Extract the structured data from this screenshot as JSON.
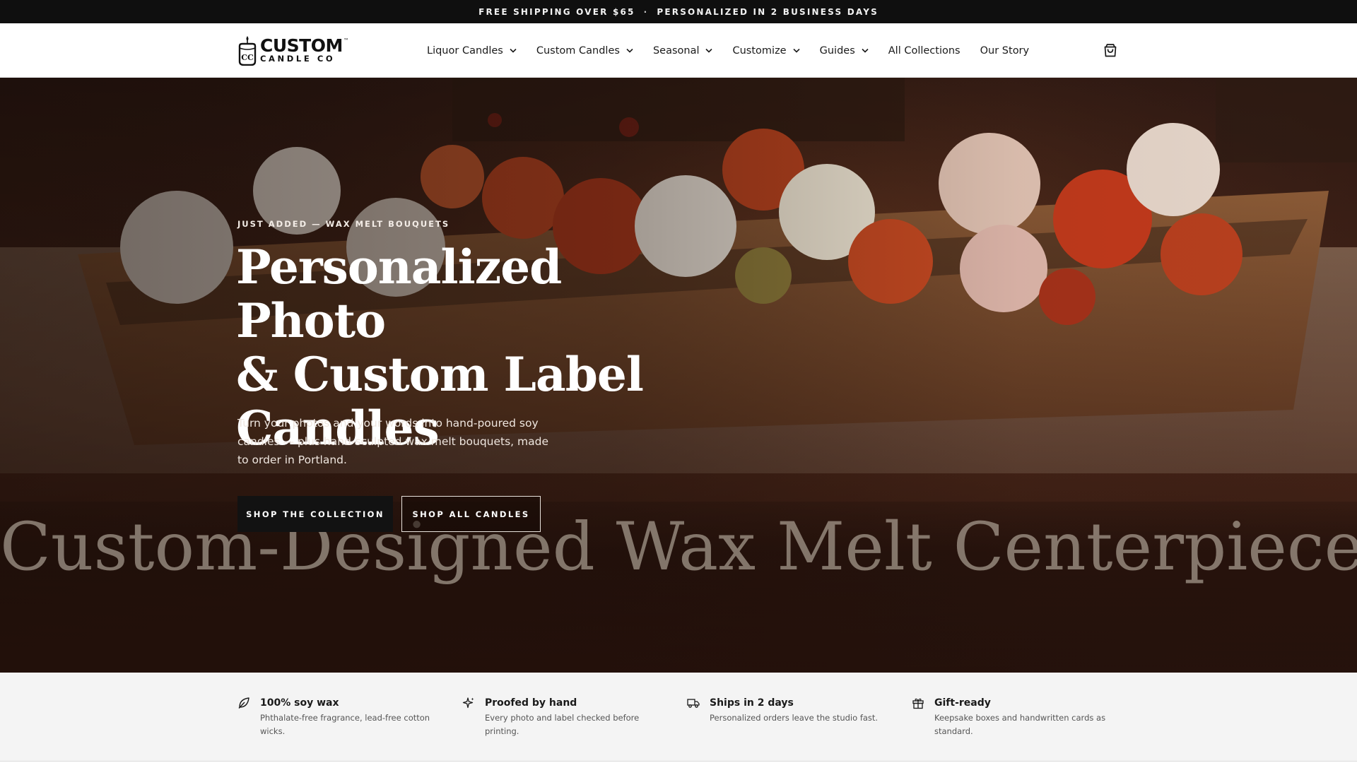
{
  "announcement": {
    "left": "FREE SHIPPING OVER $65",
    "separator": "·",
    "right": "PERSONALIZED IN 2 BUSINESS DAYS"
  },
  "header": {
    "logo": {
      "word": "CUSTOM",
      "tm": "™",
      "sub": "CANDLE CO",
      "mark_letters": "CC"
    },
    "nav": [
      {
        "label": "Liquor Candles",
        "dropdown": true
      },
      {
        "label": "Custom Candles",
        "dropdown": true
      },
      {
        "label": "Seasonal",
        "dropdown": true
      },
      {
        "label": "Customize",
        "dropdown": true
      },
      {
        "label": "Guides",
        "dropdown": true
      },
      {
        "label": "All Collections",
        "dropdown": false
      },
      {
        "label": "Our Story",
        "dropdown": false
      }
    ],
    "cart_icon": "shopping-bag-icon"
  },
  "hero": {
    "eyebrow": "JUST ADDED — WAX MELT BOUQUETS",
    "title_line1": "Personalized Photo",
    "title_line2": "& Custom Label",
    "title_line3": "Candles",
    "copy": "Turn your photos and your words into hand-poured soy candles — plus hand-sculpted wax melt bouquets, made to order in Portland.",
    "primary_button": "SHOP THE COLLECTION",
    "secondary_button": "SHOP ALL CANDLES",
    "image_caption": "Custom-Designed Wax Melt Centerpiece"
  },
  "features": [
    {
      "icon": "leaf-icon",
      "title": "100% soy wax",
      "desc": "Phthalate-free fragrance, lead-free cotton wicks."
    },
    {
      "icon": "sparkle-icon",
      "title": "Proofed by hand",
      "desc": "Every photo and label checked before printing."
    },
    {
      "icon": "truck-icon",
      "title": "Ships in 2 days",
      "desc": "Personalized orders leave the studio fast."
    },
    {
      "icon": "gift-icon",
      "title": "Gift-ready",
      "desc": "Keepsake boxes and handwritten cards as standard."
    }
  ],
  "colors": {
    "announcement_bg": "#0f0f0f",
    "primary_button_bg": "#121212",
    "features_bg": "#f4f4f4"
  }
}
